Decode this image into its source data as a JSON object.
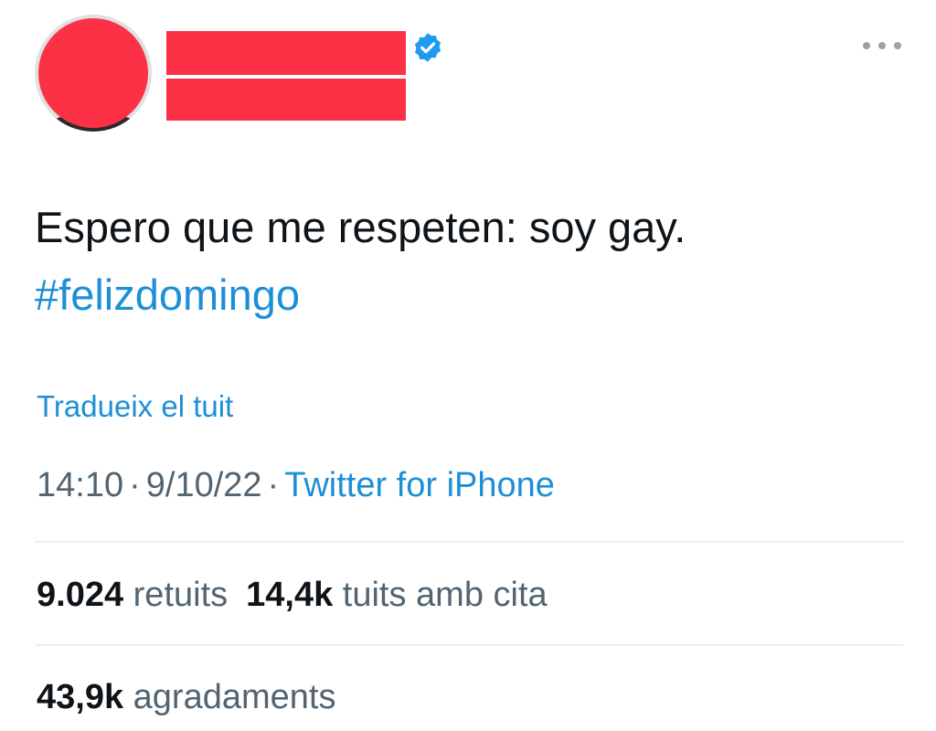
{
  "tweet": {
    "text": "Espero que me respeten: soy gay.",
    "hashtag": "#felizdomingo",
    "translate_label": "Tradueix el tuit",
    "time": "14:10",
    "date": "9/10/22",
    "separator": "·",
    "source": "Twitter for iPhone"
  },
  "stats": {
    "retweets_count": "9.024",
    "retweets_label": "retuits",
    "quotes_count": "14,4k",
    "quotes_label": "tuits amb cita",
    "likes_count": "43,9k",
    "likes_label": "agradaments"
  },
  "colors": {
    "redaction": "#fc3146",
    "link": "#1d8fd6",
    "verified": "#1d9bf0",
    "muted": "#536471"
  },
  "icons": {
    "verified": "verified-badge-icon",
    "more": "more-horizontal-icon"
  }
}
